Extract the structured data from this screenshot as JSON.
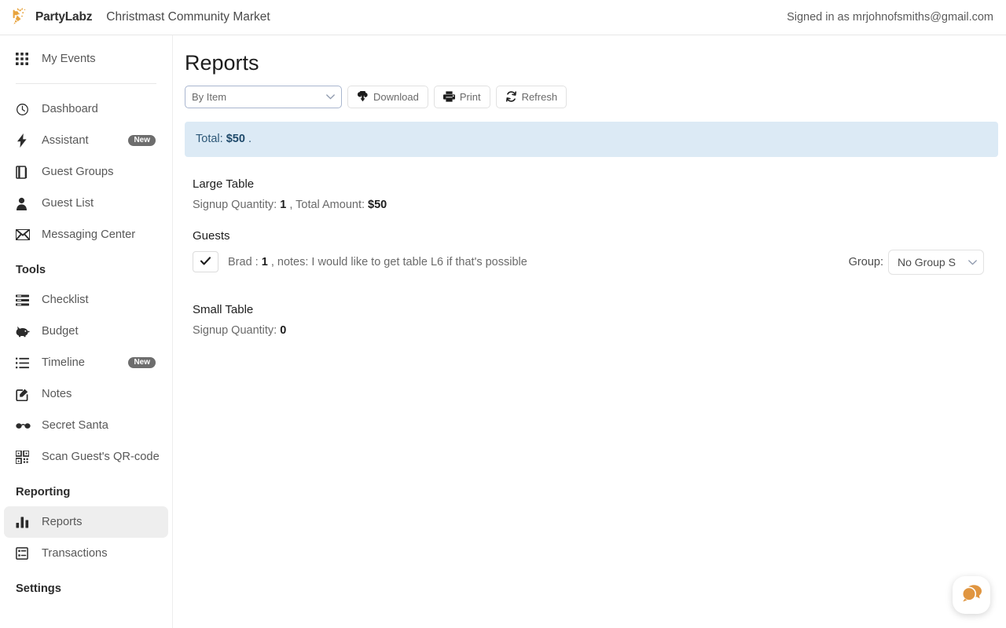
{
  "header": {
    "brand": "PartyLabz",
    "logo_icon": "party-popper-logo-icon",
    "event_title": "Christmast Community Market",
    "signed_in": "Signed in as mrjohnofsmiths@gmail.com"
  },
  "sidebar": {
    "top": [
      {
        "label": "My Events",
        "icon": "grid-apps-icon",
        "active": false,
        "badge": null
      }
    ],
    "primary": [
      {
        "label": "Dashboard",
        "icon": "gauge-icon",
        "active": false,
        "badge": null
      },
      {
        "label": "Assistant",
        "icon": "lightning-bolt-icon",
        "active": false,
        "badge": "New"
      },
      {
        "label": "Guest Groups",
        "icon": "book-icon",
        "active": false,
        "badge": null
      },
      {
        "label": "Guest List",
        "icon": "person-icon",
        "active": false,
        "badge": null
      },
      {
        "label": "Messaging Center",
        "icon": "envelope-icon",
        "active": false,
        "badge": null
      }
    ],
    "tools_title": "Tools",
    "tools": [
      {
        "label": "Checklist",
        "icon": "checklist-icon",
        "active": false,
        "badge": null
      },
      {
        "label": "Budget",
        "icon": "piggy-bank-icon",
        "active": false,
        "badge": null
      },
      {
        "label": "Timeline",
        "icon": "list-icon",
        "active": false,
        "badge": "New"
      },
      {
        "label": "Notes",
        "icon": "note-edit-icon",
        "active": false,
        "badge": null
      },
      {
        "label": "Secret Santa",
        "icon": "glasses-icon",
        "active": false,
        "badge": null
      },
      {
        "label": "Scan Guest's QR-code",
        "icon": "qr-code-icon",
        "active": false,
        "badge": null
      }
    ],
    "reporting_title": "Reporting",
    "reporting": [
      {
        "label": "Reports",
        "icon": "bar-chart-icon",
        "active": true,
        "badge": null
      },
      {
        "label": "Transactions",
        "icon": "receipt-list-icon",
        "active": false,
        "badge": null
      }
    ],
    "settings_title": "Settings"
  },
  "main": {
    "page_title": "Reports",
    "toolbar": {
      "report_type_value": "By Item",
      "report_type_options": [
        "By Item"
      ],
      "download_label": "Download",
      "download_icon": "cloud-download-icon",
      "print_label": "Print",
      "print_icon": "printer-icon",
      "refresh_label": "Refresh",
      "refresh_icon": "refresh-icon"
    },
    "total_banner": {
      "label": "Total:",
      "amount": "$50",
      "suffix": "."
    },
    "items": [
      {
        "name": "Large Table",
        "stats_label_qty": "Signup Quantity:",
        "qty": "1",
        "stats_sep": ", Total Amount:",
        "amount": "$50",
        "guests_heading": "Guests",
        "guests": [
          {
            "check_icon": "checkmark-icon",
            "text_prefix": "Brad :",
            "quantity": "1",
            "text_suffix": ", notes: I would like to get table L6 if that's possible",
            "group_label": "Group:",
            "group_value": "No Group S",
            "group_options": [
              "No Group S"
            ]
          }
        ]
      },
      {
        "name": "Small Table",
        "stats_label_qty": "Signup Quantity:",
        "qty": "0",
        "stats_sep": "",
        "amount": "",
        "guests_heading": "",
        "guests": []
      }
    ]
  },
  "chat_widget": {
    "icon": "chat-bubbles-icon",
    "color": "#e89b3c"
  }
}
